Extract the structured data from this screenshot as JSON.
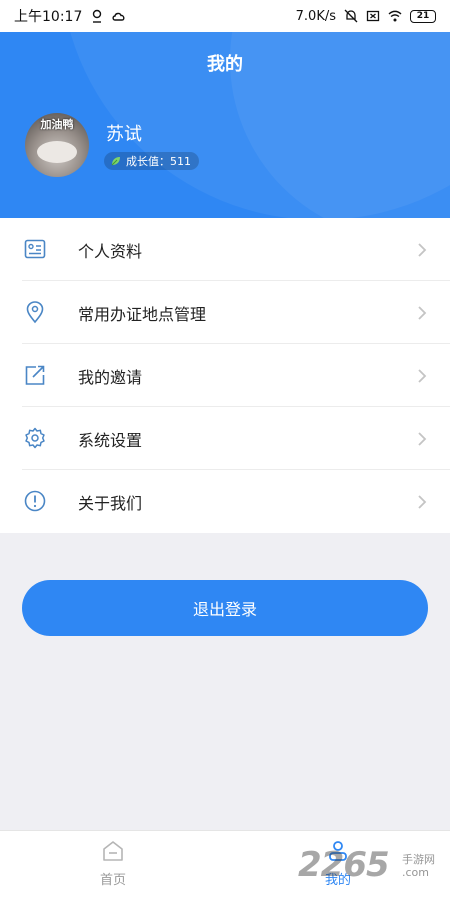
{
  "status_bar": {
    "time": "上午10:17",
    "network_speed": "7.0K/s",
    "battery": "21"
  },
  "header": {
    "title": "我的",
    "avatar_caption": "加油鸭",
    "username": "苏试",
    "growth_label": "成长值：511"
  },
  "menu": {
    "items": [
      {
        "label": "个人资料",
        "icon": "profile-card-icon"
      },
      {
        "label": "常用办证地点管理",
        "icon": "location-pin-icon"
      },
      {
        "label": "我的邀请",
        "icon": "share-icon"
      },
      {
        "label": "系统设置",
        "icon": "gear-icon"
      },
      {
        "label": "关于我们",
        "icon": "info-icon"
      }
    ]
  },
  "logout_label": "退出登录",
  "tabbar": {
    "home_label": "首页",
    "me_label": "我的"
  },
  "watermark": {
    "number": "2265",
    "site_cn": "手游网",
    "site_en": ".com"
  },
  "colors": {
    "primary": "#2f87f3",
    "background": "#efeff3",
    "icon": "#4a86c5"
  }
}
